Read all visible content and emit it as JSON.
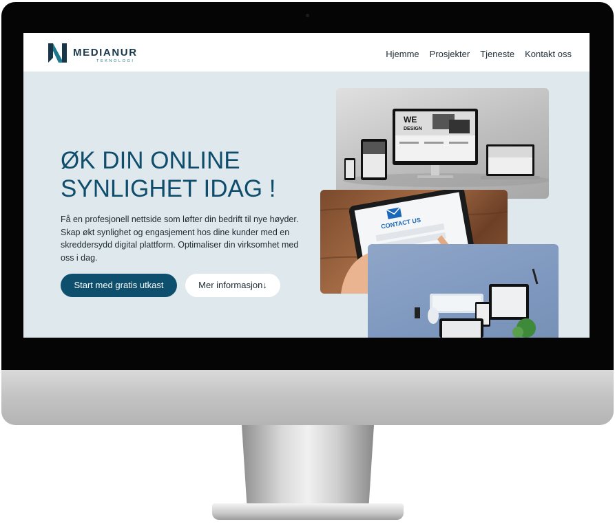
{
  "brand": {
    "name": "MEDIANUR",
    "tagline": "TEKNOLOGI",
    "logo_color": "#1c7a8e"
  },
  "nav": {
    "items": [
      "Hjemme",
      "Prosjekter",
      "Tjeneste",
      "Kontakt oss"
    ]
  },
  "hero": {
    "title_line1": "ØK DIN ONLINE",
    "title_line2": "SYNLIGHET IDAG !",
    "description": "Få en profesjonell nettside som løfter din bedrift til nye høyder. Skap økt synlighet og engasjement hos dine kunder med en skreddersydd digital plattform. Optimaliser din virksomhet med oss i dag.",
    "primary_button": "Start med gratis utkast",
    "secondary_button": "Mer informasjon↓"
  },
  "images": {
    "devices_screen_text_1": "WE",
    "devices_screen_text_2": "DESIGN",
    "tablet_header": "CONTACT US"
  },
  "colors": {
    "accent": "#0e4f6e",
    "hero_background": "#dfe8ed",
    "title": "#0e4d6b"
  }
}
